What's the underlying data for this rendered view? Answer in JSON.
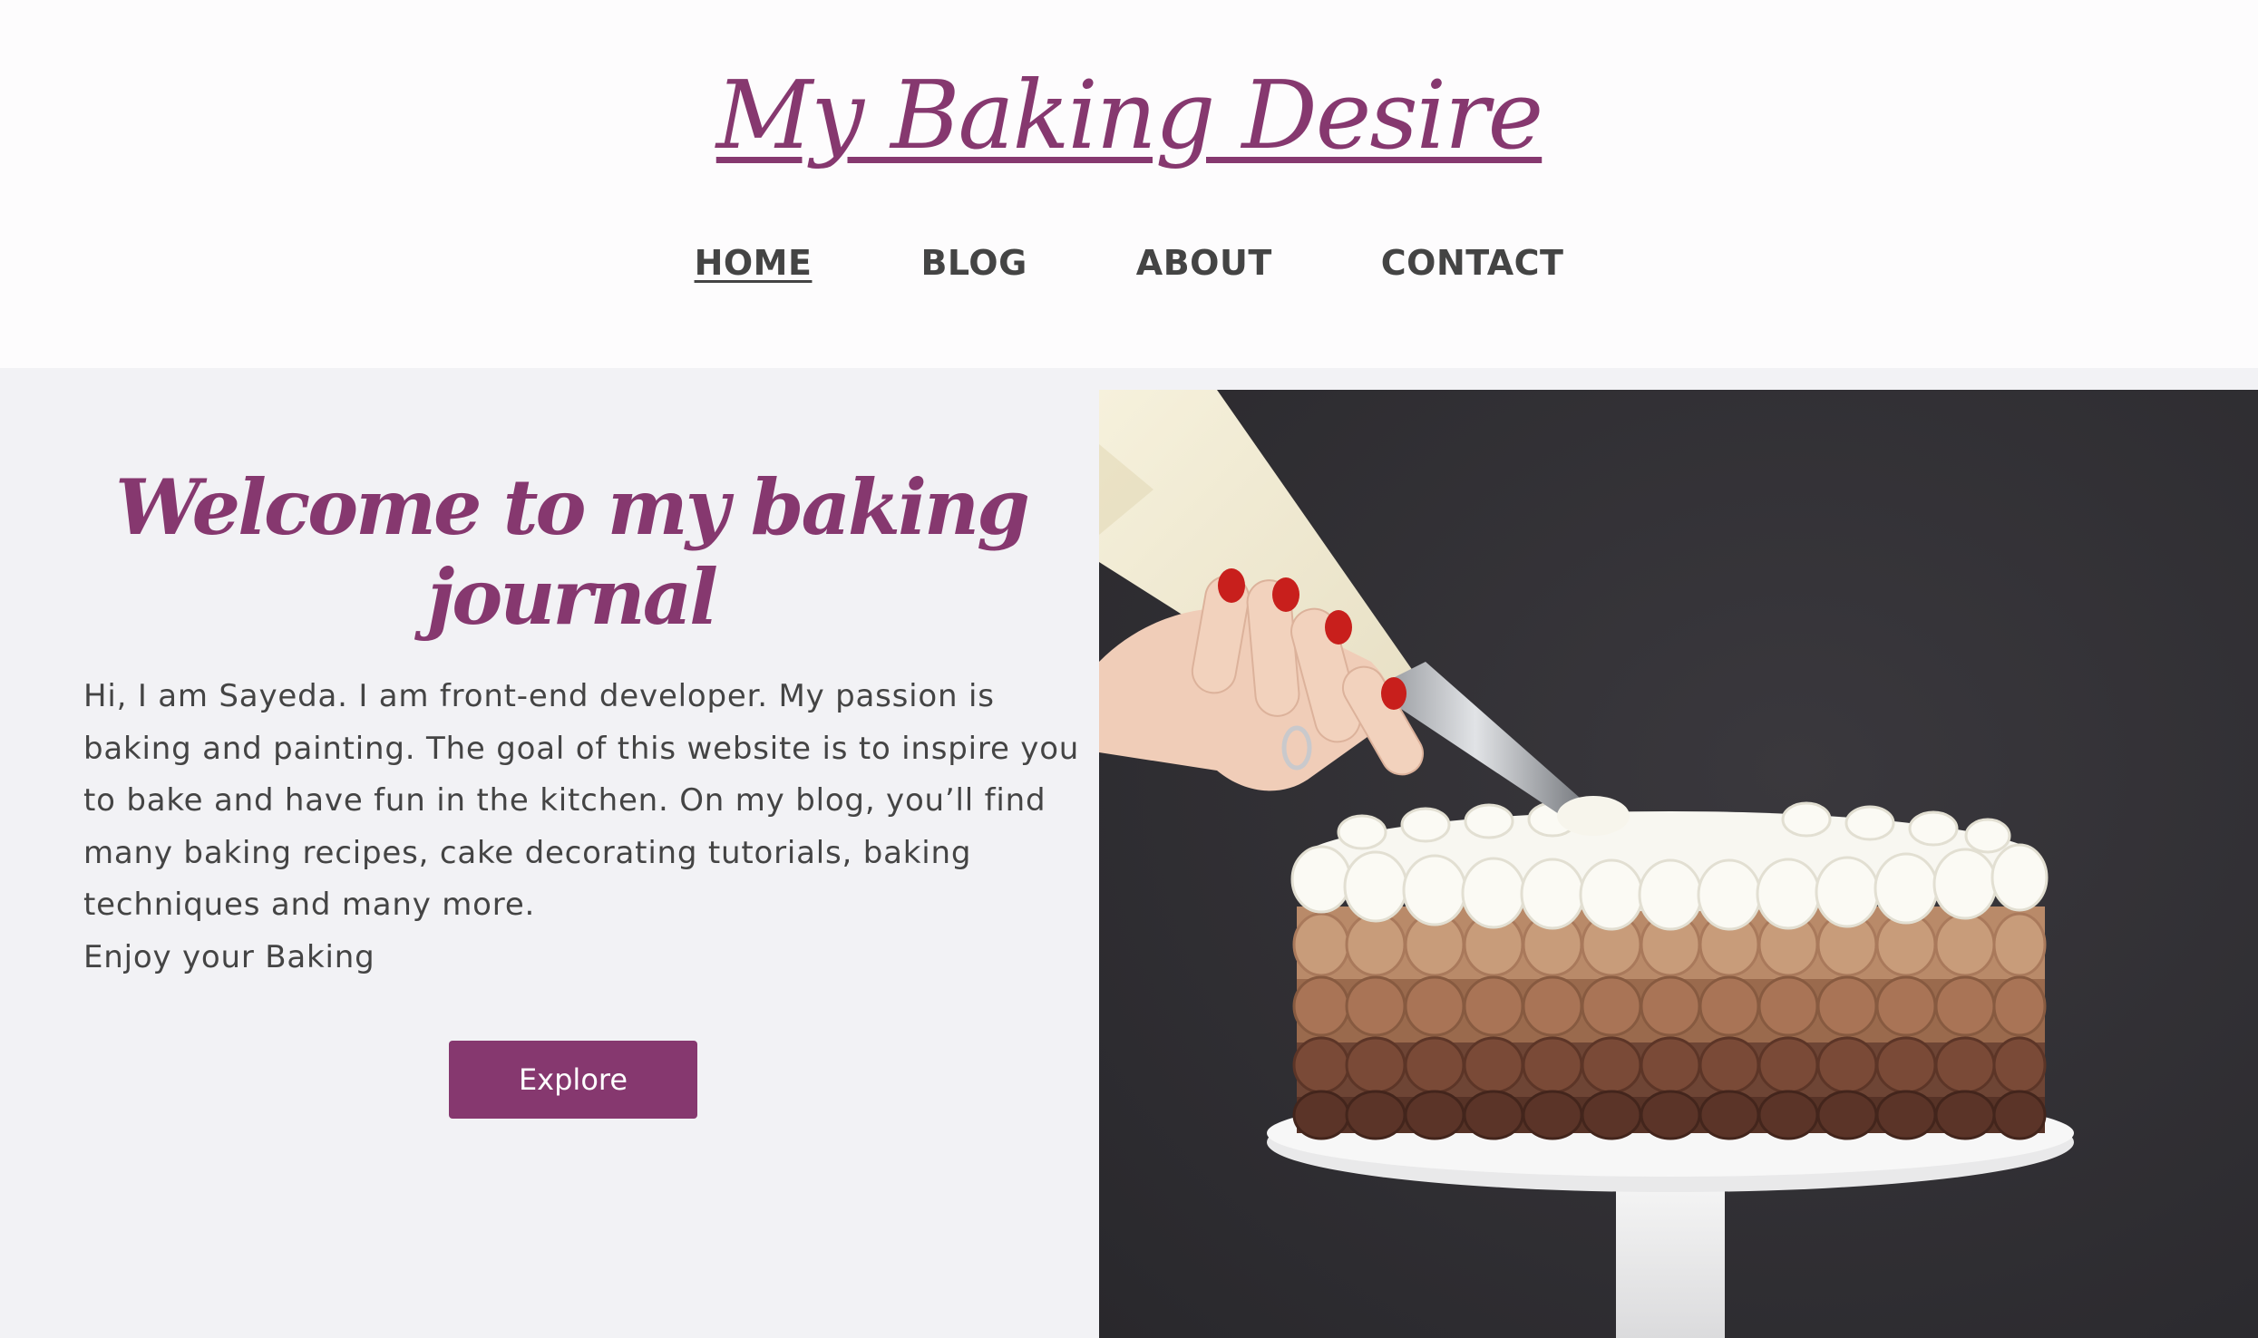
{
  "site": {
    "title": "My Baking Desire"
  },
  "nav": {
    "items": [
      {
        "label": "HOME",
        "active": true
      },
      {
        "label": "BLOG",
        "active": false
      },
      {
        "label": "ABOUT",
        "active": false
      },
      {
        "label": "CONTACT",
        "active": false
      }
    ]
  },
  "hero": {
    "heading": "Welcome to my baking journal",
    "intro_paragraph": "Hi, I am Sayeda. I am front-end developer. My passion is baking and painting. The goal of this website is to inspire you to bake and have fun in the kitchen. On my blog, you’ll find many baking recipes, cake decorating tutorials, baking techniques and many more.",
    "closing_line": "Enjoy your Baking",
    "button_label": "Explore"
  },
  "colors": {
    "brand": "#86386f",
    "header_bg": "#fdfcfd",
    "page_bg": "#f2f2f5",
    "text": "#444444"
  }
}
